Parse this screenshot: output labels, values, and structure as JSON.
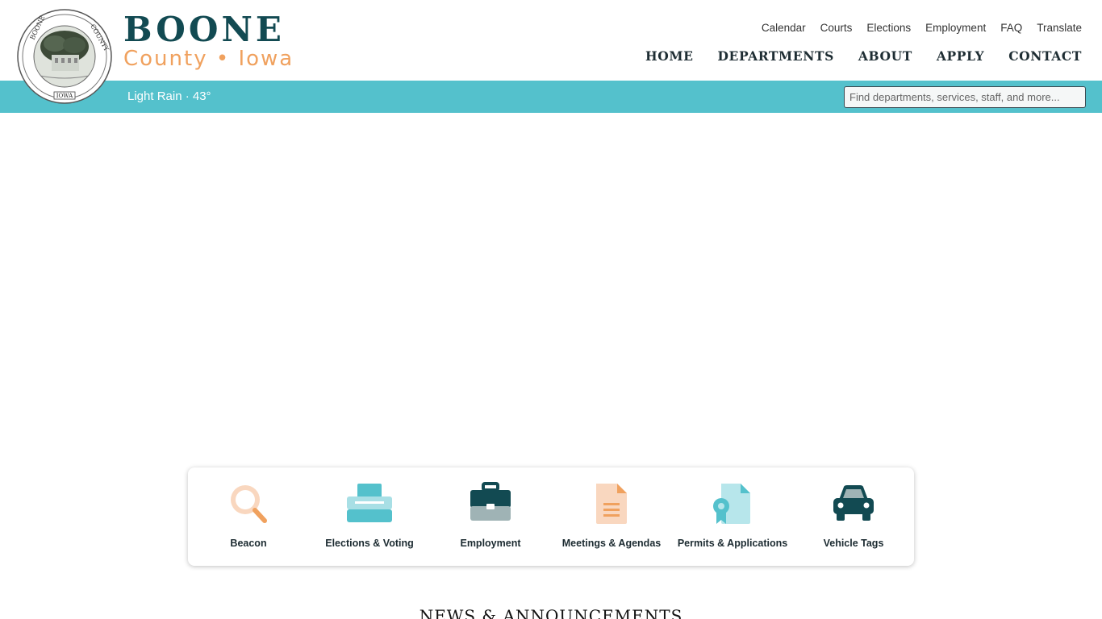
{
  "brand": {
    "name": "BOONE",
    "subtitle": "County • Iowa"
  },
  "utility_nav": [
    "Calendar",
    "Courts",
    "Elections",
    "Employment",
    "FAQ",
    "Translate"
  ],
  "main_nav": [
    "HOME",
    "DEPARTMENTS",
    "ABOUT",
    "APPLY",
    "CONTACT"
  ],
  "weather": "Light Rain · 43°",
  "search": {
    "placeholder": "Find departments, services, staff, and more..."
  },
  "quick_links": [
    {
      "label": "Beacon",
      "icon": "magnifier-icon"
    },
    {
      "label": "Elections & Voting",
      "icon": "ballot-box-icon"
    },
    {
      "label": "Employment",
      "icon": "briefcase-icon"
    },
    {
      "label": "Meetings & Agendas",
      "icon": "document-icon"
    },
    {
      "label": "Permits & Applications",
      "icon": "certificate-icon"
    },
    {
      "label": "Vehicle Tags",
      "icon": "car-icon"
    }
  ],
  "news_heading": "NEWS & ANNOUNCEMENTS",
  "colors": {
    "teal_dark": "#124a52",
    "teal_bar": "#54c1cc",
    "orange": "#f0a15e",
    "peach": "#f9d7bf"
  }
}
